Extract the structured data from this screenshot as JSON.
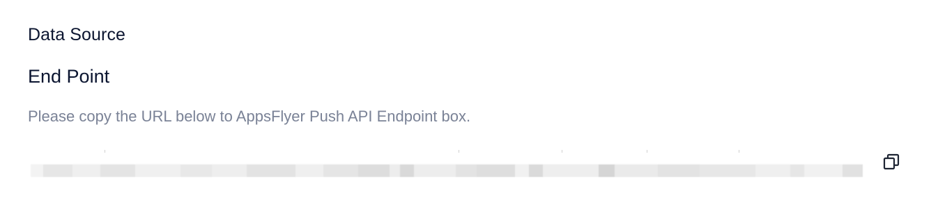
{
  "section": {
    "title": "Data Source"
  },
  "endpoint": {
    "label": "End Point",
    "help_text": "Please copy the URL below to AppsFlyer Push API Endpoint box.",
    "url": ""
  },
  "actions": {
    "copy_icon": "copy-icon"
  },
  "colors": {
    "heading": "#0b1530",
    "help_text": "#7a8296",
    "icon": "#1d2433"
  }
}
